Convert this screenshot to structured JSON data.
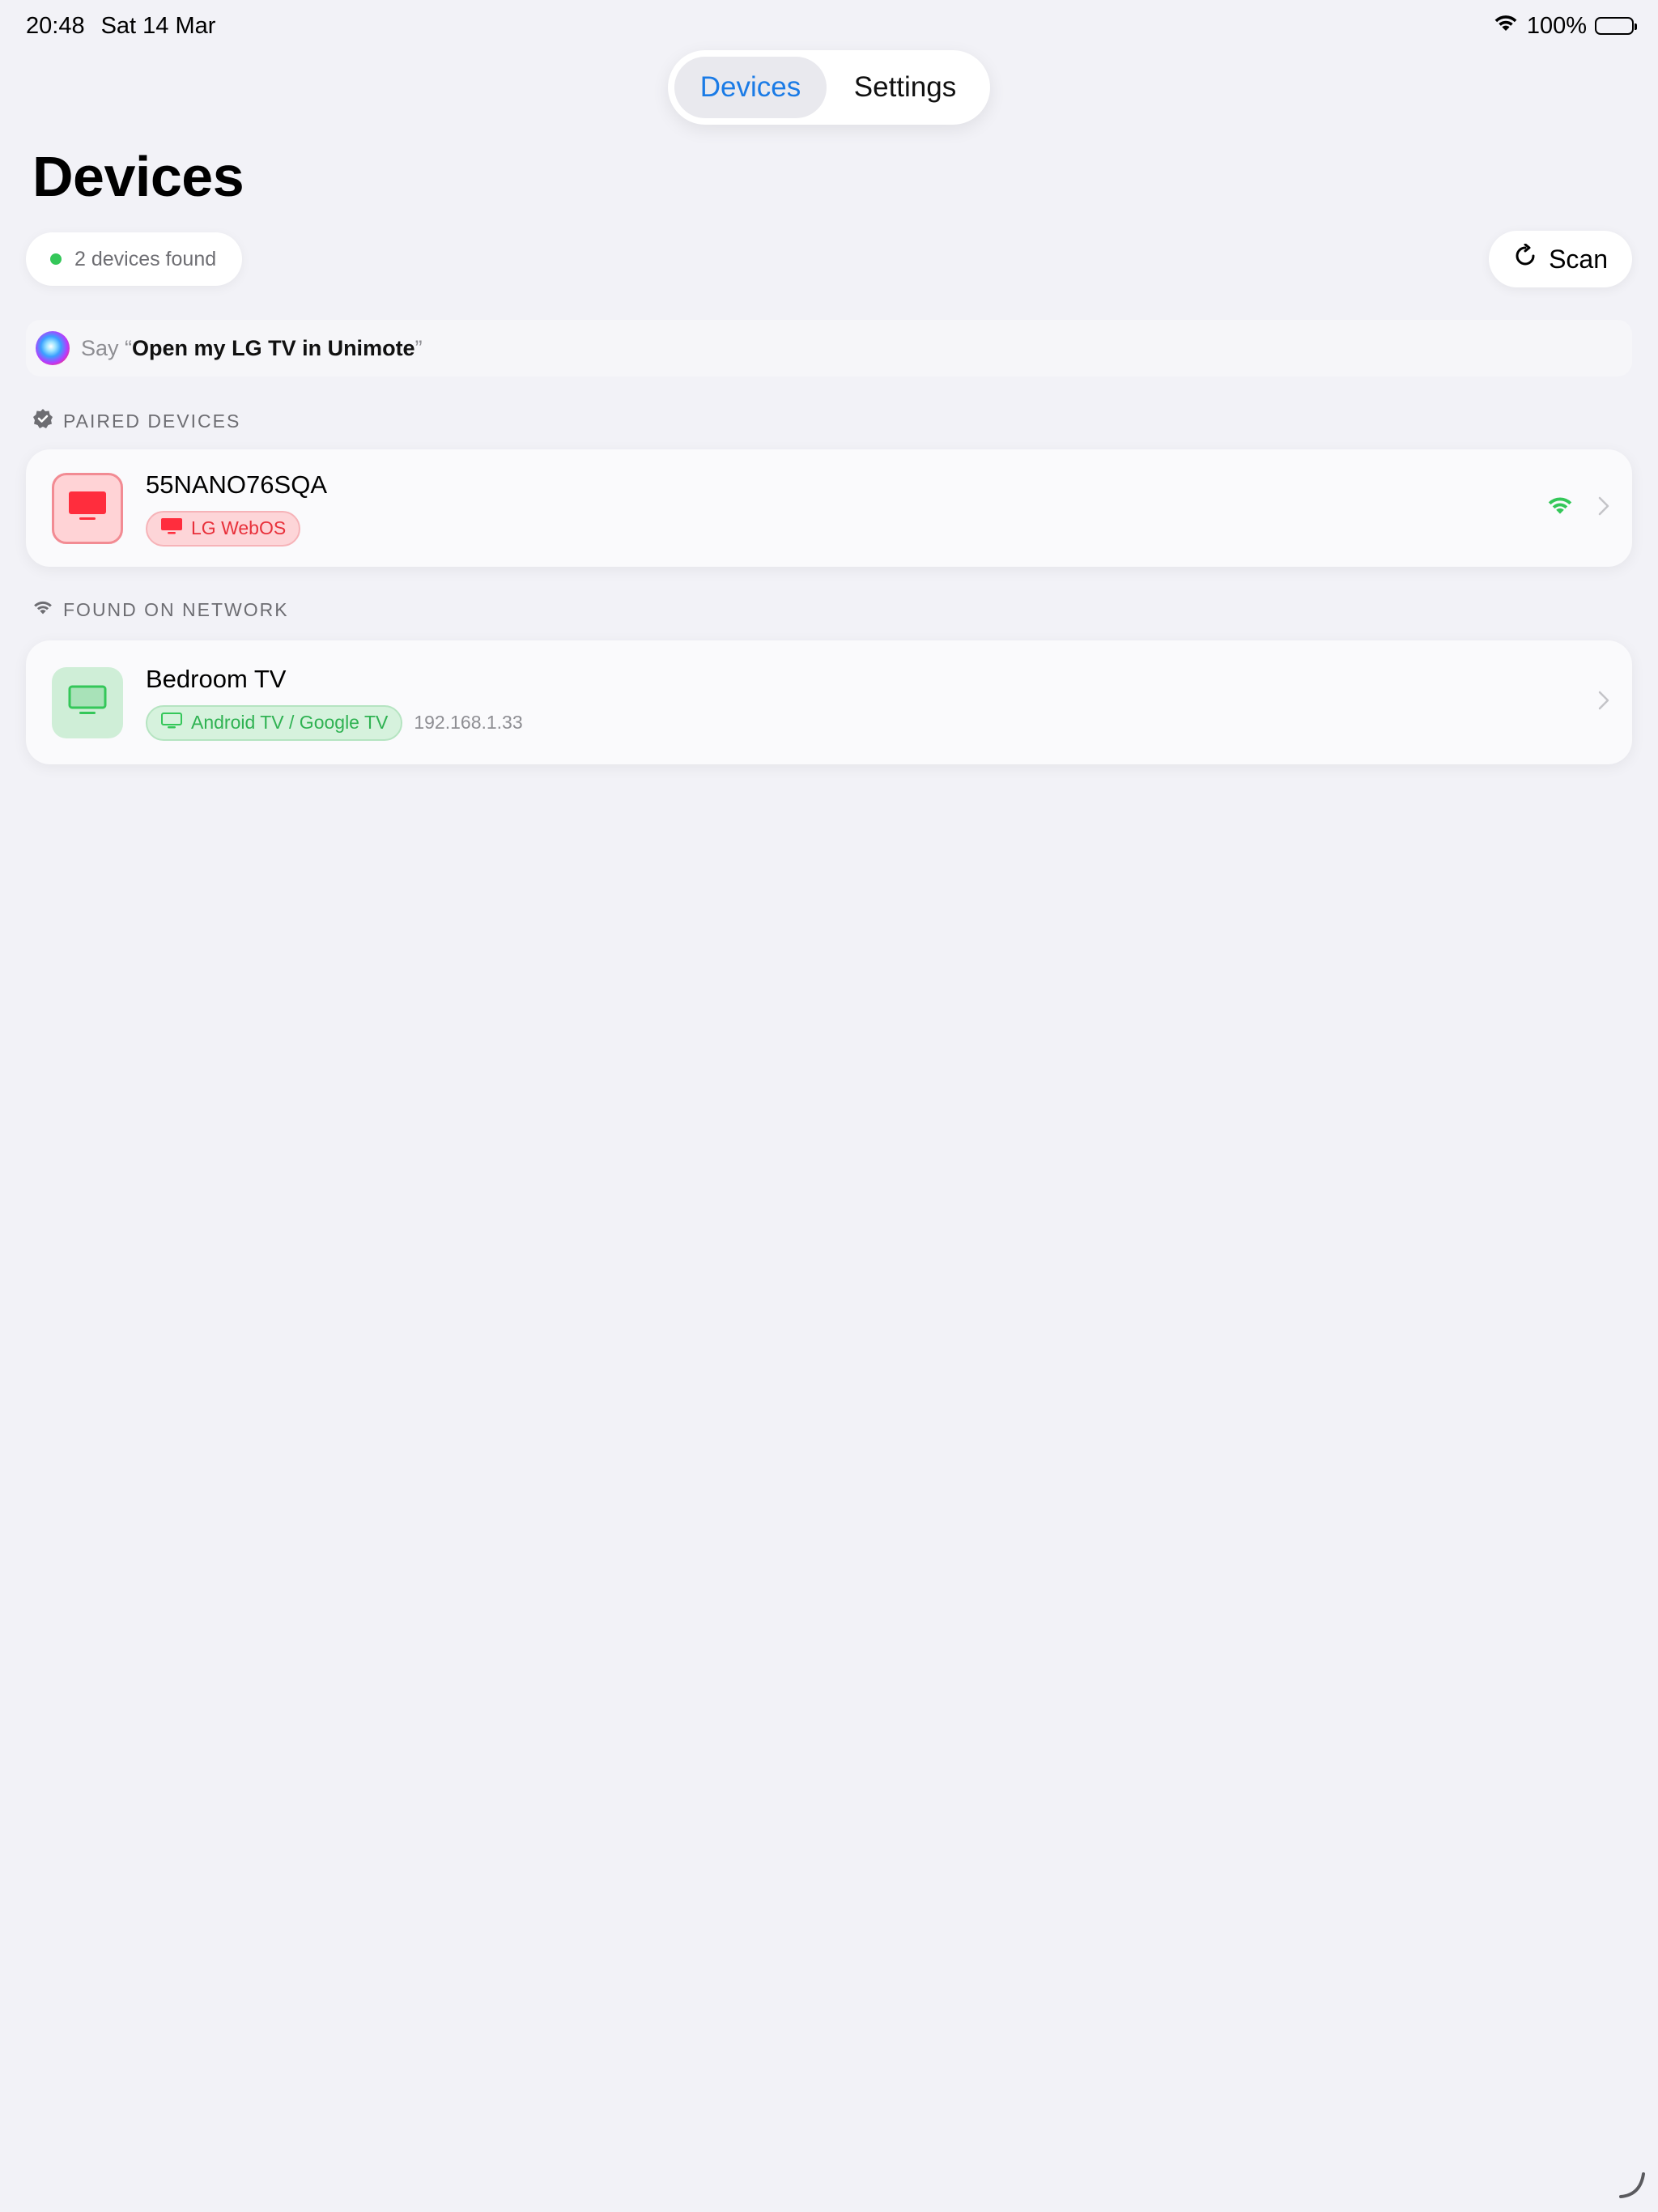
{
  "status_bar": {
    "time": "20:48",
    "date": "Sat 14 Mar",
    "battery": "100%"
  },
  "tabs": [
    {
      "label": "Devices",
      "active": true
    },
    {
      "label": "Settings",
      "active": false
    }
  ],
  "header": {
    "title": "Devices",
    "status_text": "2 devices found",
    "scan_label": "Scan"
  },
  "siri_hint": {
    "say": "Say",
    "open_quote": "“",
    "phrase": "Open my LG TV in Unimote",
    "close_quote": "”"
  },
  "sections": {
    "paired": {
      "title": "PAIRED DEVICES",
      "devices": [
        {
          "name": "55NANO76SQA",
          "platform": "LG WebOS",
          "accent": "#ff2d3d",
          "connected": true
        }
      ]
    },
    "network": {
      "title": "FOUND ON NETWORK",
      "devices": [
        {
          "name": "Bedroom TV",
          "platform": "Android TV / Google TV",
          "ip": "192.168.1.33",
          "accent": "#34c759"
        }
      ]
    }
  },
  "colors": {
    "accent_blue": "#1a7be6",
    "status_green": "#34c759",
    "lg_red": "#ff2d3d",
    "background": "#f2f2f7"
  }
}
